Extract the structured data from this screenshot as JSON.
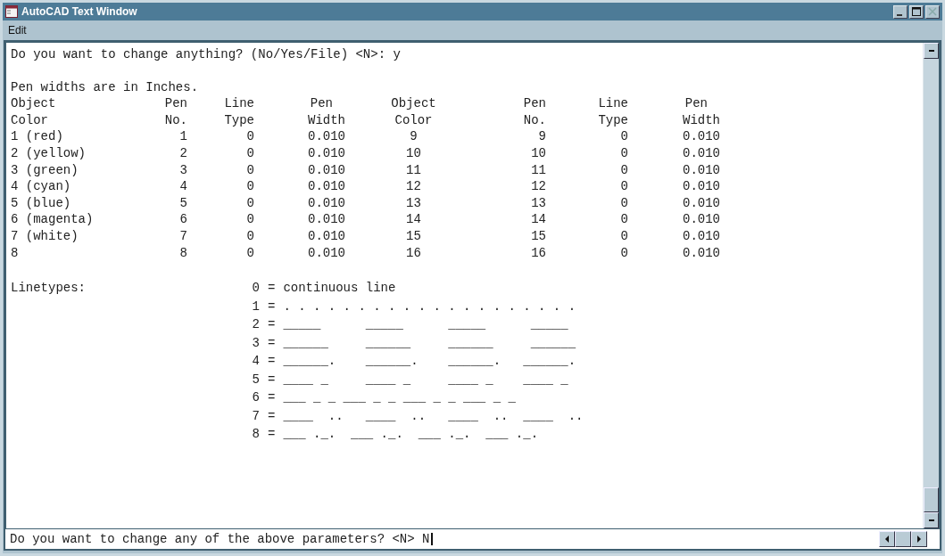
{
  "window": {
    "title": "AutoCAD Text Window"
  },
  "menu": [
    {
      "label": "Edit"
    }
  ],
  "prompt": "Do you want to change anything? (No/Yes/File) <N>: y",
  "note": "Pen widths are in Inches.",
  "table": {
    "columns": [
      {
        "top": "Object",
        "bottom": "Color"
      },
      {
        "top": "Pen",
        "bottom": "No."
      },
      {
        "top": "Line",
        "bottom": "Type"
      },
      {
        "top": "Pen",
        "bottom": "Width"
      },
      {
        "top": "Object",
        "bottom": "Color"
      },
      {
        "top": "Pen",
        "bottom": "No."
      },
      {
        "top": "Line",
        "bottom": "Type"
      },
      {
        "top": "Pen",
        "bottom": "Width"
      }
    ],
    "rows": [
      [
        "1 (red)",
        "1",
        "0",
        "0.010",
        "9",
        "9",
        "0",
        "0.010"
      ],
      [
        "2 (yellow)",
        "2",
        "0",
        "0.010",
        "10",
        "10",
        "0",
        "0.010"
      ],
      [
        "3 (green)",
        "3",
        "0",
        "0.010",
        "11",
        "11",
        "0",
        "0.010"
      ],
      [
        "4 (cyan)",
        "4",
        "0",
        "0.010",
        "12",
        "12",
        "0",
        "0.010"
      ],
      [
        "5 (blue)",
        "5",
        "0",
        "0.010",
        "13",
        "13",
        "0",
        "0.010"
      ],
      [
        "6 (magenta)",
        "6",
        "0",
        "0.010",
        "14",
        "14",
        "0",
        "0.010"
      ],
      [
        "7 (white)",
        "7",
        "0",
        "0.010",
        "15",
        "15",
        "0",
        "0.010"
      ],
      [
        "8",
        "8",
        "0",
        "0.010",
        "16",
        "16",
        "0",
        "0.010"
      ]
    ]
  },
  "linetypes": {
    "label": "Linetypes:",
    "sign": "=",
    "items": [
      {
        "number": "0",
        "text": "continuous line"
      },
      {
        "number": "1",
        "text": ". . . . . . . . . . . . . . . . . . . ."
      },
      {
        "number": "2",
        "text": "_____      _____      _____      _____"
      },
      {
        "number": "3",
        "text": "______     ______     ______     ______"
      },
      {
        "number": "4",
        "text": "______.    ______.    ______.   ______."
      },
      {
        "number": "5",
        "text": "____ _     ____ _     ____ _    ____ _"
      },
      {
        "number": "6",
        "text": "___ _ _ ___ _ _ ___ _ _ ___ _ _"
      },
      {
        "number": "7",
        "text": "____  ..   ____  ..   ____  ..  ____  .."
      },
      {
        "number": "8",
        "text": "___ ._.  ___ ._.  ___ ._.  ___ ._."
      }
    ]
  },
  "command_line": {
    "value": "Do you want to change any of the above parameters? <N> N"
  }
}
